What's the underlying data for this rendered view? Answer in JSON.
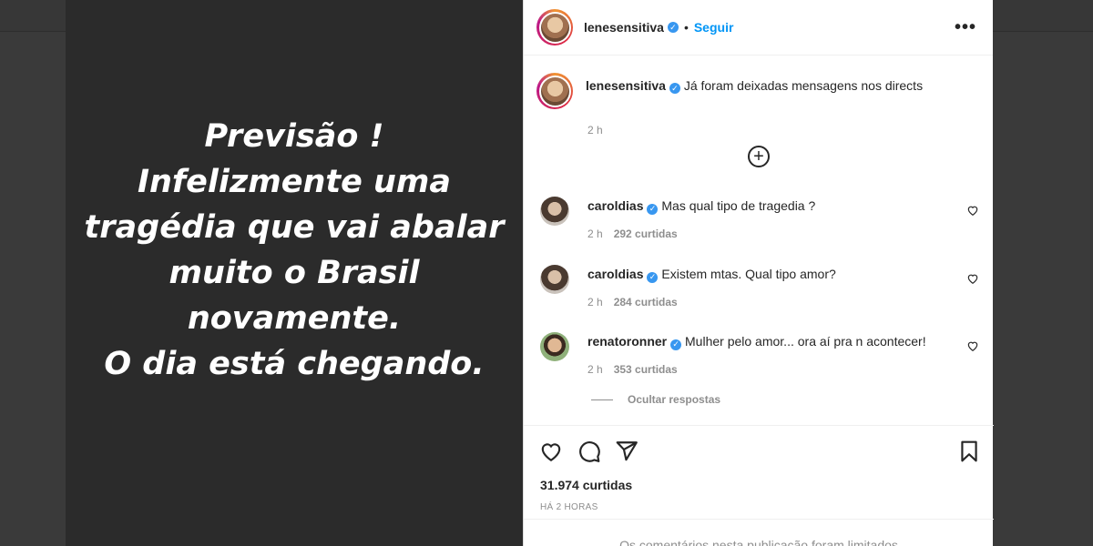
{
  "media": {
    "lines": [
      "Previsão !",
      "Infelizmente uma",
      "tragédia que vai abalar",
      "muito o Brasil",
      "novamente.",
      "O dia está chegando."
    ]
  },
  "header": {
    "username": "lenesensitiva",
    "separator": "•",
    "follow_label": "Seguir",
    "more_label": "•••"
  },
  "caption": {
    "username": "lenesensitiva",
    "text": "Já foram deixadas mensagens nos directs",
    "time": "2 h"
  },
  "comments": [
    {
      "username": "caroldias",
      "text": "Mas qual tipo de tragedia ?",
      "time": "2 h",
      "likes": "292 curtidas"
    },
    {
      "username": "caroldias",
      "text": "Existem mtas. Qual tipo amor?",
      "time": "2 h",
      "likes": "284 curtidas"
    },
    {
      "username": "renatoronner",
      "text": "Mulher pelo amor... ora aí pra n acontecer!",
      "time": "2 h",
      "likes": "353 curtidas"
    }
  ],
  "hide_replies_label": "Ocultar respostas",
  "actions": {
    "icons": [
      "heart-icon",
      "comment-icon",
      "share-icon",
      "bookmark-icon"
    ],
    "likes_total": "31.974 curtidas",
    "time_ago": "HÁ 2 HORAS"
  },
  "footer": {
    "limited_text": "Os comentários nesta publicação foram limitados"
  },
  "colors": {
    "accent": "#0095f6",
    "verified": "#3897f0",
    "media_bg": "#2b2b2b"
  }
}
